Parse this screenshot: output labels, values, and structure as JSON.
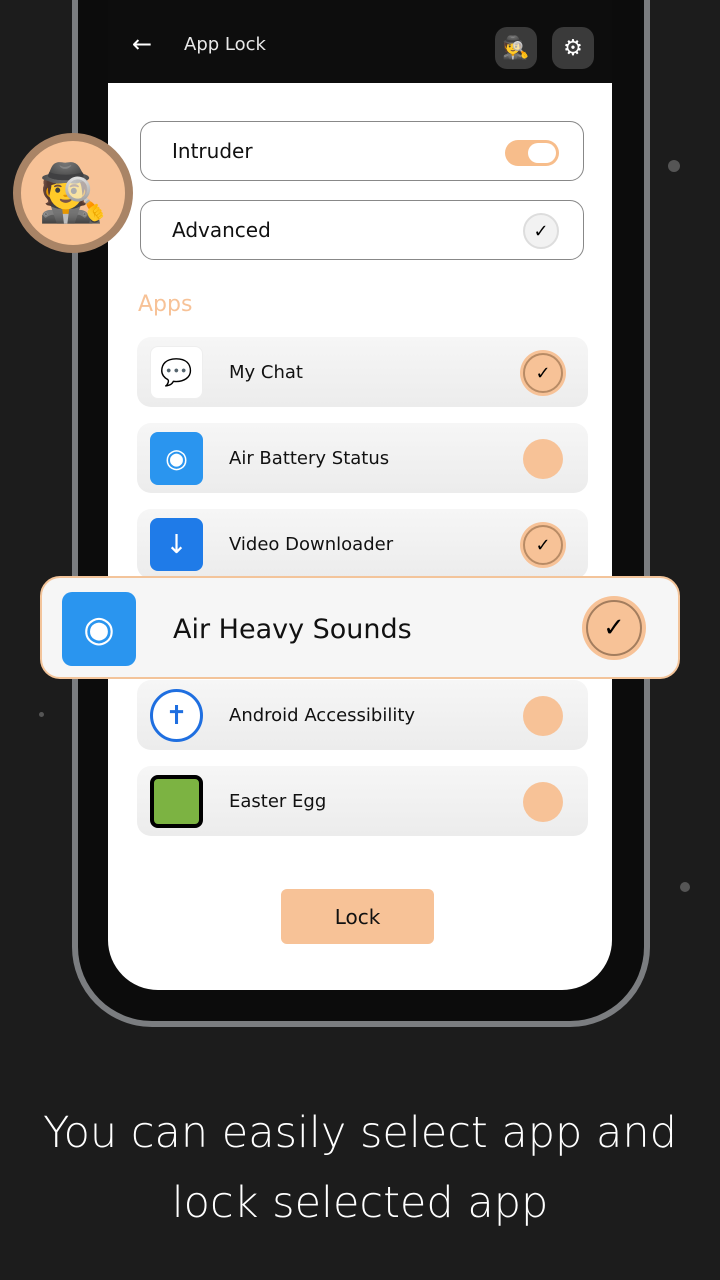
{
  "header": {
    "title": "App Lock",
    "back_icon": "arrow-left-icon",
    "intruder_icon": "spy-icon",
    "settings_icon": "gear-icon"
  },
  "options": {
    "intruder_label": "Intruder",
    "intruder_enabled": true,
    "advanced_label": "Advanced",
    "advanced_checked": true
  },
  "apps_heading": "Apps",
  "apps": [
    {
      "name": "My Chat",
      "selected": true
    },
    {
      "name": "Air Battery Status",
      "selected": false
    },
    {
      "name": "Video Downloader",
      "selected": true
    },
    {
      "name": "Air Heavy Sounds",
      "selected": true
    },
    {
      "name": "Android Accessibility",
      "selected": false
    },
    {
      "name": "Easter Egg",
      "selected": false
    }
  ],
  "lock_label": "Lock",
  "caption": {
    "line1": "You can easily select app and",
    "line2": "lock selected app"
  },
  "colors": {
    "accent": "#f7c297",
    "background": "#1c1c1c"
  }
}
